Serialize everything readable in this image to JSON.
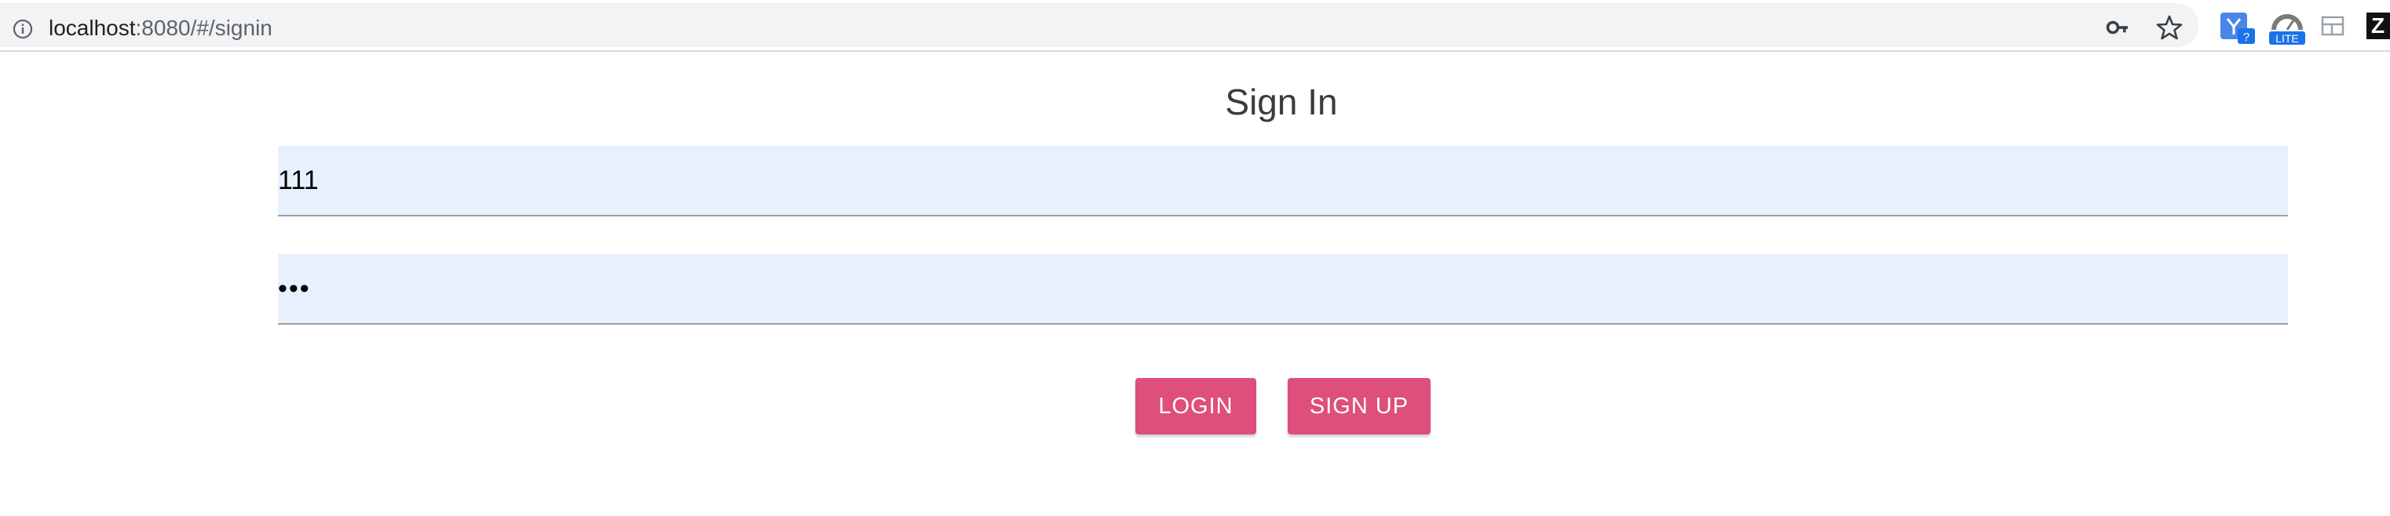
{
  "browser": {
    "url_host": "localhost",
    "url_rest": ":8080/#/signin",
    "icons": [
      "info-icon",
      "key-icon",
      "star-icon",
      "extension-icon",
      "lite-extension-icon",
      "tab-layout-icon",
      "zoom-extension-icon"
    ],
    "lite_badge": "LITE",
    "ext_badge": "?",
    "z_label": "Z"
  },
  "form": {
    "title": "Sign In",
    "username_value": "111",
    "password_value": "•••",
    "login_label": "LOGIN",
    "signup_label": "SIGN UP"
  },
  "colors": {
    "button": "#de4f7b",
    "field_bg": "#e8f0fe",
    "title": "#3b3b3b"
  }
}
